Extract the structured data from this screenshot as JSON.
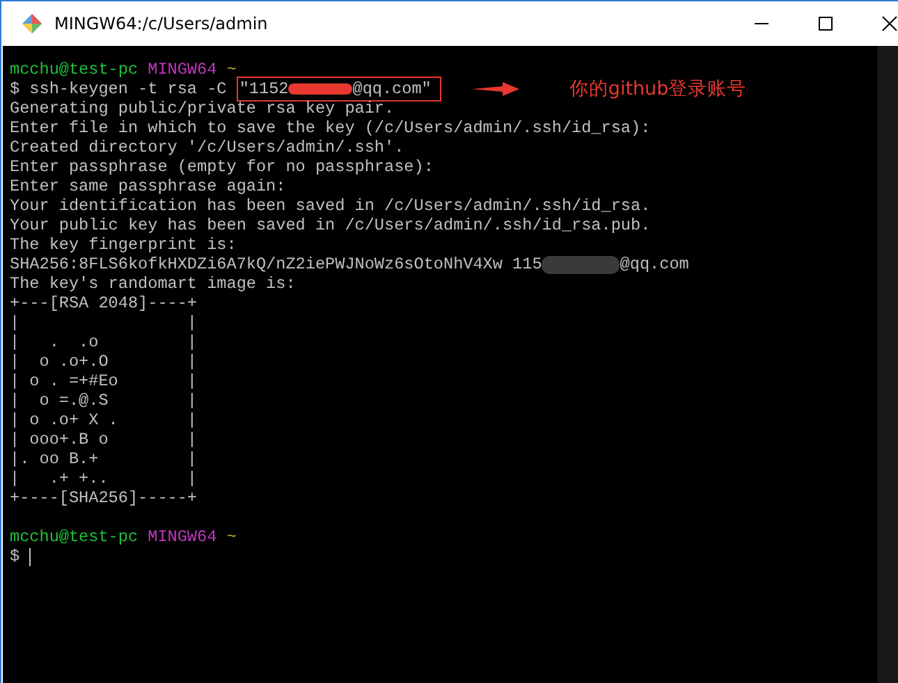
{
  "window": {
    "title": "MINGW64:/c/Users/admin"
  },
  "terminal": {
    "lines": [
      {
        "kind": "prompt",
        "user": "mcchu@test-pc",
        "shell": "MINGW64",
        "path": "~"
      },
      {
        "kind": "command",
        "sign": "$",
        "text": "ssh-keygen -t rsa -C",
        "boxed_before": "\"1152",
        "boxed_after": "@qq.com\""
      },
      {
        "kind": "output",
        "text": "Generating public/private rsa key pair."
      },
      {
        "kind": "output",
        "text": "Enter file in which to save the key (/c/Users/admin/.ssh/id_rsa):"
      },
      {
        "kind": "output",
        "text": "Created directory '/c/Users/admin/.ssh'."
      },
      {
        "kind": "output",
        "text": "Enter passphrase (empty for no passphrase):"
      },
      {
        "kind": "output",
        "text": "Enter same passphrase again:"
      },
      {
        "kind": "output",
        "text": "Your identification has been saved in /c/Users/admin/.ssh/id_rsa."
      },
      {
        "kind": "output",
        "text": "Your public key has been saved in /c/Users/admin/.ssh/id_rsa.pub."
      },
      {
        "kind": "output",
        "text": "The key fingerprint is:"
      },
      {
        "kind": "redacted",
        "text": "SHA256:8FLS6kofkHXDZi6A7kQ/nZ2iePWJNoWz6sOtoNhV4Xw 115",
        "after": "@qq.com"
      },
      {
        "kind": "output",
        "text": "The key's randomart image is:"
      },
      {
        "kind": "output",
        "text": "+---[RSA 2048]----+"
      },
      {
        "kind": "output",
        "text": "|                 |"
      },
      {
        "kind": "output",
        "text": "|   .  .o         |"
      },
      {
        "kind": "output",
        "text": "|  o .o+.O        |"
      },
      {
        "kind": "output",
        "text": "| o . =+#Eo       |"
      },
      {
        "kind": "output",
        "text": "|  o =.@.S        |"
      },
      {
        "kind": "output",
        "text": "| o .o+ X .       |"
      },
      {
        "kind": "output",
        "text": "| ooo+.B o        |"
      },
      {
        "kind": "output",
        "text": "|. oo B.+         |"
      },
      {
        "kind": "output",
        "text": "|   .+ +..        |"
      },
      {
        "kind": "output",
        "text": "+----[SHA256]-----+"
      },
      {
        "kind": "blank"
      },
      {
        "kind": "prompt",
        "user": "mcchu@test-pc",
        "shell": "MINGW64",
        "path": "~"
      },
      {
        "kind": "input",
        "sign": "$"
      }
    ]
  },
  "annotation": {
    "text": "你的github登录账号"
  }
}
